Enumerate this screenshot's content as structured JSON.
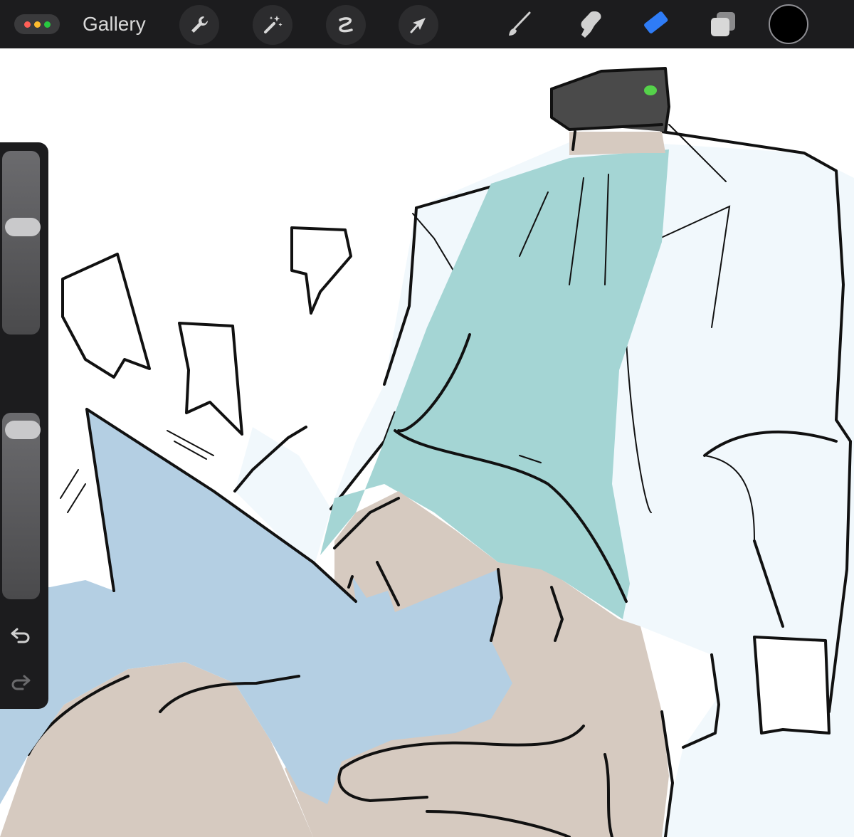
{
  "toolbar": {
    "gallery_label": "Gallery",
    "window_dots": [
      "#ff5f57",
      "#febc2e",
      "#28c840"
    ],
    "actions": [
      "wrench-icon",
      "magic-wand-icon",
      "selection-icon",
      "transform-arrow-icon"
    ],
    "painting_tools": [
      "brush-icon",
      "smudge-icon",
      "eraser-icon",
      "layers-icon"
    ],
    "active_tool": "eraser-icon",
    "active_tool_color": "#2f7cf6",
    "current_color": "#000000"
  },
  "sidebar": {
    "brush_size_level": 0.6,
    "opacity_level": 0.97,
    "controls": [
      "modify-square-icon",
      "undo-icon",
      "redo-icon"
    ]
  },
  "canvas": {
    "palette": {
      "blanket": "#b4cfe3",
      "shirt": "#a4d5d4",
      "skin": "#d6cac0",
      "coat": "#f1f8fc",
      "hat": "#4a4a4a",
      "hat_light": "#55d24a",
      "ink": "#111111"
    }
  }
}
